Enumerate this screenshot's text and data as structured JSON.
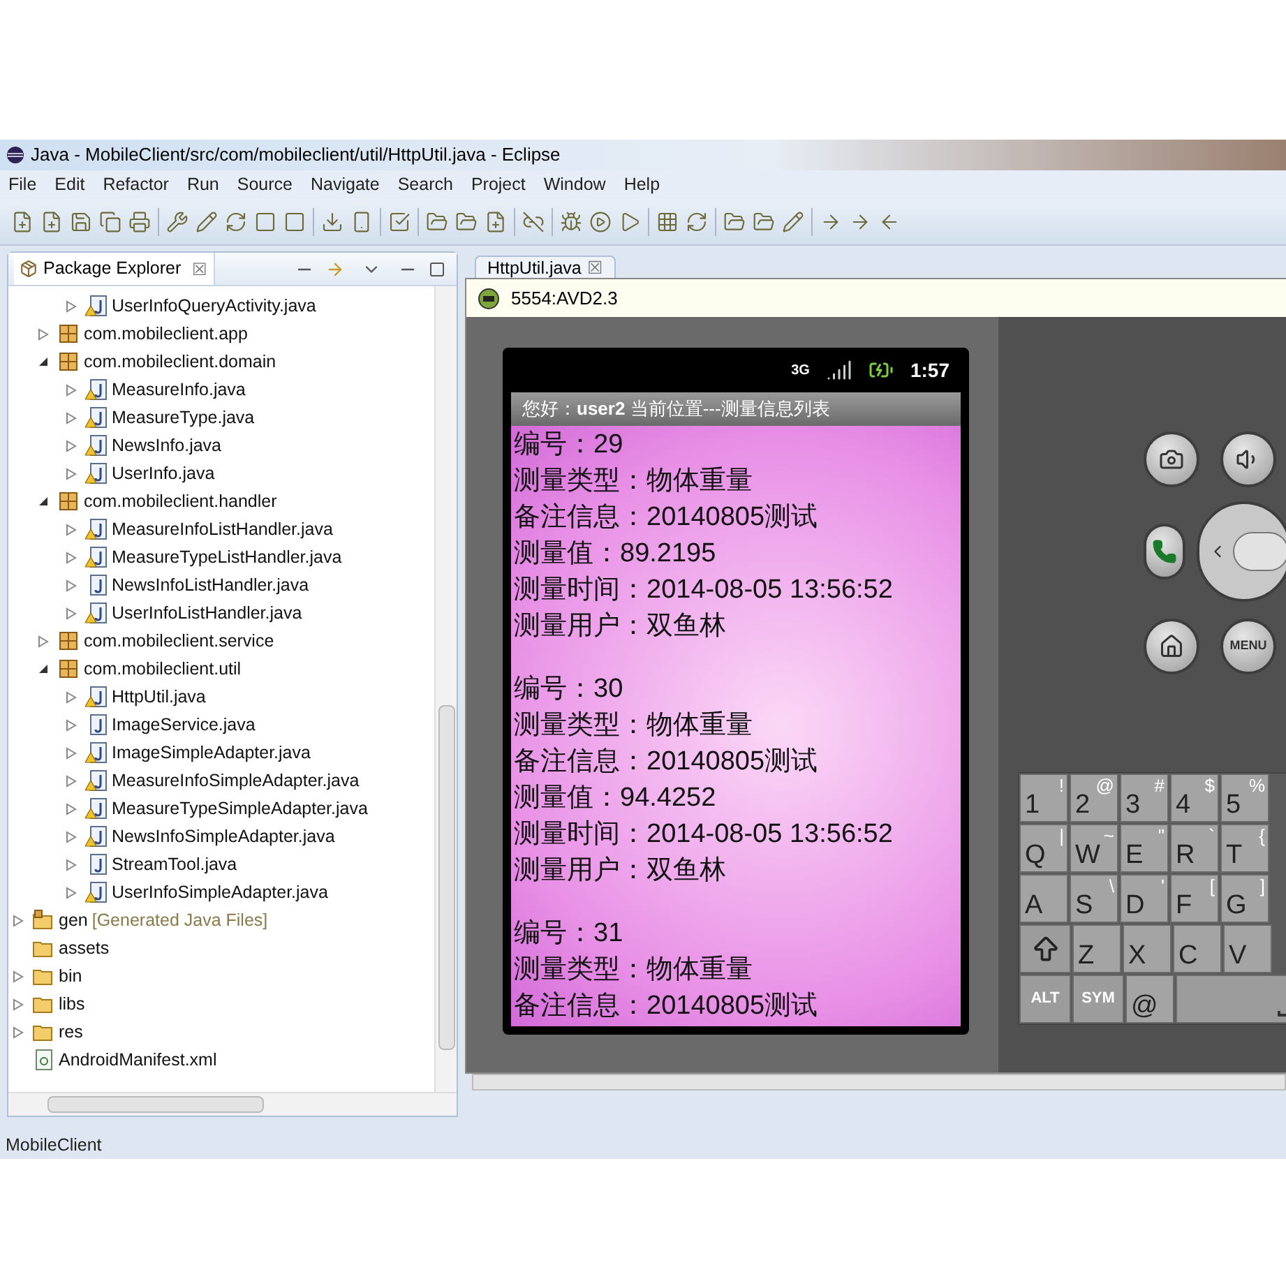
{
  "window": {
    "title": "Java - MobileClient/src/com/mobileclient/util/HttpUtil.java - Eclipse"
  },
  "menu": [
    "File",
    "Edit",
    "Refactor",
    "Run",
    "Source",
    "Navigate",
    "Search",
    "Project",
    "Window",
    "Help"
  ],
  "package_explorer": {
    "title": "Package Explorer",
    "close": "☒",
    "tree": [
      {
        "children": [
          {
            "children": [
              {
                "children": [
                  {
                    "label": "UserInfoQueryActivity.java",
                    "kind": "file",
                    "warning": true,
                    "expanded": false
                  }
                ]
              },
              {
                "label": "com.mobileclient.app",
                "kind": "package",
                "expanded": false
              },
              {
                "label": "com.mobileclient.domain",
                "kind": "package",
                "expanded": true,
                "children": [
                  {
                    "label": "MeasureInfo.java",
                    "kind": "file",
                    "warning": true,
                    "expanded": false
                  },
                  {
                    "label": "MeasureType.java",
                    "kind": "file",
                    "warning": true,
                    "expanded": false
                  },
                  {
                    "label": "NewsInfo.java",
                    "kind": "file",
                    "warning": true,
                    "expanded": false
                  },
                  {
                    "label": "UserInfo.java",
                    "kind": "file",
                    "warning": true,
                    "expanded": false
                  }
                ]
              },
              {
                "label": "com.mobileclient.handler",
                "kind": "package",
                "expanded": true,
                "children": [
                  {
                    "label": "MeasureInfoListHandler.java",
                    "kind": "file",
                    "warning": true,
                    "expanded": false
                  },
                  {
                    "label": "MeasureTypeListHandler.java",
                    "kind": "file",
                    "warning": true,
                    "expanded": false
                  },
                  {
                    "label": "NewsInfoListHandler.java",
                    "kind": "file",
                    "warning": false,
                    "expanded": false
                  },
                  {
                    "label": "UserInfoListHandler.java",
                    "kind": "file",
                    "warning": true,
                    "expanded": false
                  }
                ]
              },
              {
                "label": "com.mobileclient.service",
                "kind": "package",
                "expanded": false
              },
              {
                "label": "com.mobileclient.util",
                "kind": "package",
                "expanded": true,
                "children": [
                  {
                    "label": "HttpUtil.java",
                    "kind": "file",
                    "warning": true,
                    "expanded": false
                  },
                  {
                    "label": "ImageService.java",
                    "kind": "file",
                    "warning": false,
                    "expanded": false
                  },
                  {
                    "label": "ImageSimpleAdapter.java",
                    "kind": "file",
                    "warning": true,
                    "expanded": false
                  },
                  {
                    "label": "MeasureInfoSimpleAdapter.java",
                    "kind": "file",
                    "warning": true,
                    "expanded": false
                  },
                  {
                    "label": "MeasureTypeSimpleAdapter.java",
                    "kind": "file",
                    "warning": true,
                    "expanded": false
                  },
                  {
                    "label": "NewsInfoSimpleAdapter.java",
                    "kind": "file",
                    "warning": true,
                    "expanded": false
                  },
                  {
                    "label": "StreamTool.java",
                    "kind": "file",
                    "warning": false,
                    "expanded": false
                  },
                  {
                    "label": "UserInfoSimpleAdapter.java",
                    "kind": "file",
                    "warning": true,
                    "expanded": false
                  }
                ]
              }
            ]
          },
          {
            "label": "gen",
            "note": "[Generated Java Files]",
            "kind": "srcfolder",
            "expanded": false
          },
          {
            "label": "assets",
            "kind": "folder"
          },
          {
            "label": "bin",
            "kind": "folder",
            "expanded": false
          },
          {
            "label": "libs",
            "kind": "folder",
            "expanded": false
          },
          {
            "label": "res",
            "kind": "folder",
            "expanded": false
          },
          {
            "label": "AndroidManifest.xml",
            "kind": "xml"
          }
        ]
      }
    ]
  },
  "editor_tab": {
    "label": "HttpUtil.java",
    "close": "☒"
  },
  "emulator": {
    "title": "5554:AVD2.3",
    "phone": {
      "network": "3G",
      "time": "1:57",
      "header": "您好：**user2**   当前位置---测量信息列表",
      "lines": [
        "编号：29",
        "测量类型：物体重量",
        "备注信息：20140805测试",
        "测量值：89.2195",
        "测量时间：2014-08-05 13:56:52",
        "测量用户：双鱼林",
        "编号：30",
        "测量类型：物体重量",
        "备注信息：20140805测试",
        "测量值：94.4252",
        "测量时间：2014-08-05 13:56:52",
        "测量用户：双鱼林",
        "编号：31",
        "测量类型：物体重量",
        "备注信息：20140805测试"
      ]
    },
    "menu_button": "MENU",
    "keyboard": [
      [
        {
          "kind": "char",
          "main": "1",
          "alt": "!"
        },
        {
          "kind": "char",
          "main": "2",
          "alt": "@"
        },
        {
          "kind": "char",
          "main": "3",
          "alt": "#"
        },
        {
          "kind": "char",
          "main": "4",
          "alt": "$"
        },
        {
          "kind": "char",
          "main": "5",
          "alt": "%"
        }
      ],
      [
        {
          "kind": "char",
          "main": "Q",
          "alt": "|"
        },
        {
          "kind": "char",
          "main": "W",
          "alt": "~"
        },
        {
          "kind": "char",
          "main": "E",
          "alt": "\""
        },
        {
          "kind": "char",
          "main": "R",
          "alt": "`"
        },
        {
          "kind": "char",
          "main": "T",
          "alt": "{"
        }
      ],
      [
        {
          "kind": "char",
          "main": "A"
        },
        {
          "kind": "char",
          "main": "S",
          "alt": "\\"
        },
        {
          "kind": "char",
          "main": "D",
          "alt": "'"
        },
        {
          "kind": "char",
          "main": "F",
          "alt": "["
        },
        {
          "kind": "char",
          "main": "G",
          "alt": "]"
        }
      ],
      [
        {
          "kind": "shift"
        },
        {
          "kind": "char",
          "main": "Z"
        },
        {
          "kind": "char",
          "main": "X"
        },
        {
          "kind": "char",
          "main": "C"
        },
        {
          "kind": "char",
          "main": "V"
        }
      ],
      [
        {
          "kind": "mod",
          "main": "ALT"
        },
        {
          "kind": "mod",
          "main": "SYM"
        },
        {
          "kind": "char",
          "main": "@"
        },
        {
          "kind": "space"
        }
      ]
    ]
  },
  "status_bar": {
    "text": "MobileClient"
  }
}
